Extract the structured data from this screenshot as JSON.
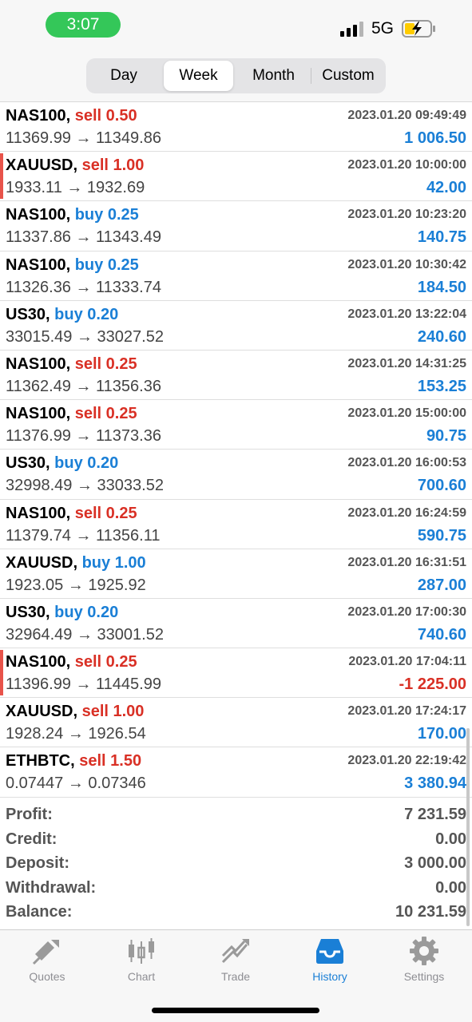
{
  "status_bar": {
    "time": "3:07",
    "network": "5G"
  },
  "segments": {
    "items": [
      {
        "label": "Day",
        "active": false
      },
      {
        "label": "Week",
        "active": true
      },
      {
        "label": "Month",
        "active": false
      },
      {
        "label": "Custom",
        "active": false
      }
    ]
  },
  "deals": [
    {
      "symbol": "NAS100,",
      "action": "sell 0.50",
      "side": "sell",
      "time": "2023.01.20 09:49:49",
      "prices": "11369.99 → 11349.86",
      "profit": "1 006.50",
      "negative": false,
      "flagged": false
    },
    {
      "symbol": "XAUUSD,",
      "action": "sell 1.00",
      "side": "sell",
      "time": "2023.01.20 10:00:00",
      "prices": "1933.11 → 1932.69",
      "profit": "42.00",
      "negative": false,
      "flagged": true
    },
    {
      "symbol": "NAS100,",
      "action": "buy 0.25",
      "side": "buy",
      "time": "2023.01.20 10:23:20",
      "prices": "11337.86 → 11343.49",
      "profit": "140.75",
      "negative": false,
      "flagged": false
    },
    {
      "symbol": "NAS100,",
      "action": "buy 0.25",
      "side": "buy",
      "time": "2023.01.20 10:30:42",
      "prices": "11326.36 → 11333.74",
      "profit": "184.50",
      "negative": false,
      "flagged": false
    },
    {
      "symbol": "US30,",
      "action": "buy 0.20",
      "side": "buy",
      "time": "2023.01.20 13:22:04",
      "prices": "33015.49 → 33027.52",
      "profit": "240.60",
      "negative": false,
      "flagged": false
    },
    {
      "symbol": "NAS100,",
      "action": "sell 0.25",
      "side": "sell",
      "time": "2023.01.20 14:31:25",
      "prices": "11362.49 → 11356.36",
      "profit": "153.25",
      "negative": false,
      "flagged": false
    },
    {
      "symbol": "NAS100,",
      "action": "sell 0.25",
      "side": "sell",
      "time": "2023.01.20 15:00:00",
      "prices": "11376.99 → 11373.36",
      "profit": "90.75",
      "negative": false,
      "flagged": false
    },
    {
      "symbol": "US30,",
      "action": "buy 0.20",
      "side": "buy",
      "time": "2023.01.20 16:00:53",
      "prices": "32998.49 → 33033.52",
      "profit": "700.60",
      "negative": false,
      "flagged": false
    },
    {
      "symbol": "NAS100,",
      "action": "sell 0.25",
      "side": "sell",
      "time": "2023.01.20 16:24:59",
      "prices": "11379.74 → 11356.11",
      "profit": "590.75",
      "negative": false,
      "flagged": false
    },
    {
      "symbol": "XAUUSD,",
      "action": "buy 1.00",
      "side": "buy",
      "time": "2023.01.20 16:31:51",
      "prices": "1923.05 → 1925.92",
      "profit": "287.00",
      "negative": false,
      "flagged": false
    },
    {
      "symbol": "US30,",
      "action": "buy 0.20",
      "side": "buy",
      "time": "2023.01.20 17:00:30",
      "prices": "32964.49 → 33001.52",
      "profit": "740.60",
      "negative": false,
      "flagged": false
    },
    {
      "symbol": "NAS100,",
      "action": "sell 0.25",
      "side": "sell",
      "time": "2023.01.20 17:04:11",
      "prices": "11396.99 → 11445.99",
      "profit": "-1 225.00",
      "negative": true,
      "flagged": true
    },
    {
      "symbol": "XAUUSD,",
      "action": "sell 1.00",
      "side": "sell",
      "time": "2023.01.20 17:24:17",
      "prices": "1928.24 → 1926.54",
      "profit": "170.00",
      "negative": false,
      "flagged": false
    },
    {
      "symbol": "ETHBTC,",
      "action": "sell 1.50",
      "side": "sell",
      "time": "2023.01.20 22:19:42",
      "prices": "0.07447 → 0.07346",
      "profit": "3 380.94",
      "negative": false,
      "flagged": false
    }
  ],
  "summary": [
    {
      "label": "Profit:",
      "value": "7 231.59"
    },
    {
      "label": "Credit:",
      "value": "0.00"
    },
    {
      "label": "Deposit:",
      "value": "3 000.00"
    },
    {
      "label": "Withdrawal:",
      "value": "0.00"
    },
    {
      "label": "Balance:",
      "value": "10 231.59"
    }
  ],
  "tabbar": {
    "items": [
      {
        "label": "Quotes",
        "icon": "quotes-icon",
        "active": false
      },
      {
        "label": "Chart",
        "icon": "chart-icon",
        "active": false
      },
      {
        "label": "Trade",
        "icon": "trade-icon",
        "active": false
      },
      {
        "label": "History",
        "icon": "history-icon",
        "active": true
      },
      {
        "label": "Settings",
        "icon": "gear-icon",
        "active": false
      }
    ]
  },
  "colors": {
    "sell": "#d93025",
    "buy": "#1a7fd6",
    "accent": "#1a7fd6",
    "status_pill": "#34c759"
  }
}
